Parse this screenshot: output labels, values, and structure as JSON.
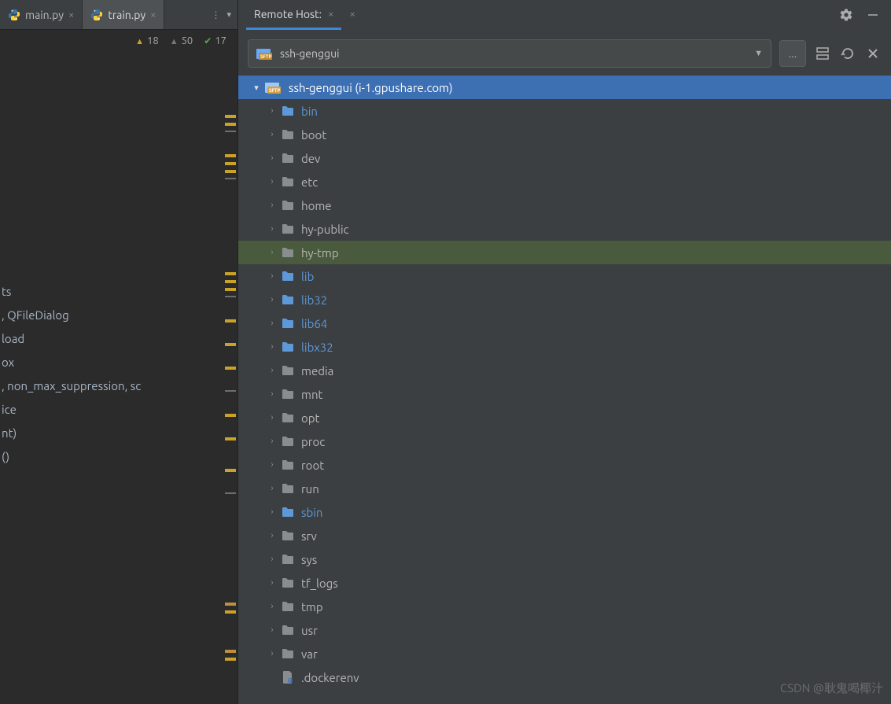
{
  "tabs": [
    {
      "label": "main.py",
      "active": false
    },
    {
      "label": "train.py",
      "active": true
    }
  ],
  "inspections": {
    "warnings": "18",
    "weak_warnings": "50",
    "passed": "17"
  },
  "code_lines": [
    "ts",
    ", QFileDialog",
    "",
    "load",
    "ox",
    ", non_max_suppression, sc",
    "",
    "ice",
    "",
    "",
    "",
    "",
    "nt)",
    "",
    "()"
  ],
  "remote_host": {
    "title": "Remote Host:",
    "selected": "ssh-genggui",
    "root_label": "ssh-genggui (i-1.gpushare.com)",
    "more_btn": "...",
    "items": [
      {
        "name": "bin",
        "link": true
      },
      {
        "name": "boot",
        "link": false
      },
      {
        "name": "dev",
        "link": false
      },
      {
        "name": "etc",
        "link": false
      },
      {
        "name": "home",
        "link": false
      },
      {
        "name": "hy-public",
        "link": false
      },
      {
        "name": "hy-tmp",
        "link": false,
        "hovered": true
      },
      {
        "name": "lib",
        "link": true
      },
      {
        "name": "lib32",
        "link": true
      },
      {
        "name": "lib64",
        "link": true
      },
      {
        "name": "libx32",
        "link": true
      },
      {
        "name": "media",
        "link": false
      },
      {
        "name": "mnt",
        "link": false
      },
      {
        "name": "opt",
        "link": false
      },
      {
        "name": "proc",
        "link": false
      },
      {
        "name": "root",
        "link": false
      },
      {
        "name": "run",
        "link": false
      },
      {
        "name": "sbin",
        "link": true
      },
      {
        "name": "srv",
        "link": false
      },
      {
        "name": "sys",
        "link": false
      },
      {
        "name": "tf_logs",
        "link": false
      },
      {
        "name": "tmp",
        "link": false
      },
      {
        "name": "usr",
        "link": false
      },
      {
        "name": "var",
        "link": false
      }
    ],
    "file_item": ".dockerenv"
  },
  "watermark": "CSDN @耿鬼喝椰汁"
}
